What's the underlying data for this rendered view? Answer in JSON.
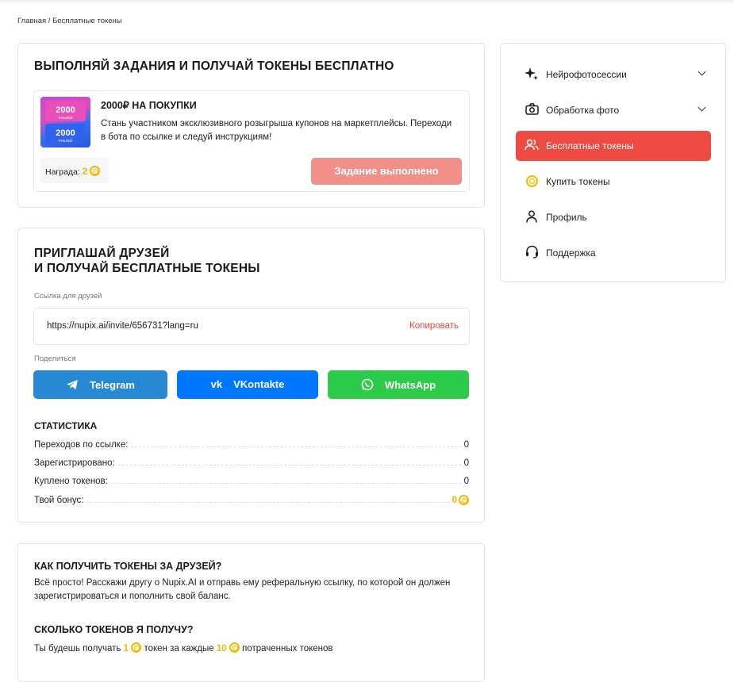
{
  "breadcrumb": "Главная / Бесплатные токены",
  "tasks_card": {
    "title": "ВЫПОЛНЯЙ ЗАДАНИЯ И ПОЛУЧАЙ ТОКЕНЫ БЕСПЛАТНО",
    "task": {
      "thumb_top_amount": "2000",
      "thumb_top_caption": "РУБЛЕЙ",
      "thumb_bottom_amount": "2000",
      "thumb_bottom_caption": "РУБЛЕЙ",
      "title": "2000₽ НА ПОКУПКИ",
      "description": "Стань участником эксклюзивного розыгрыша купонов на маркетплейсы. Переходи в бота по ссылке и следуй инструкциям!",
      "reward_label": "Награда:",
      "reward_value": "2",
      "button_label": "Задание выполнено"
    }
  },
  "invite_card": {
    "title_line1": "ПРИГЛАШАЙ ДРУЗЕЙ",
    "title_line2": "И ПОЛУЧАЙ БЕСПЛАТНЫЕ ТОКЕНЫ",
    "link_label": "Ссылка для друзей",
    "link_url": "https://nupix.ai/invite/656731?lang=ru",
    "copy_label": "Копировать",
    "share_label": "Поделиться",
    "share": {
      "telegram": "Telegram",
      "vk": "VKontakte",
      "whatsapp": "WhatsApp"
    },
    "colors": {
      "telegram": "#2789d3",
      "vk": "#0077ff",
      "whatsapp": "#2ccb49"
    },
    "stats_title": "СТАТИСТИКА",
    "stats": [
      {
        "label": "Переходов по ссылке:",
        "value": "0"
      },
      {
        "label": "Зарегистрировано:",
        "value": "0"
      },
      {
        "label": "Куплено токенов:",
        "value": "0"
      },
      {
        "label": "Твой бонус:",
        "value": "0"
      }
    ]
  },
  "faq_card": {
    "q1": "КАК ПОЛУЧИТЬ ТОКЕНЫ ЗА ДРУЗЕЙ?",
    "a1": "Всё просто! Расскажи другу о Nupix.AI и отправь ему реферальную ссылку, по которой он должен зарегистрироваться и пополнить свой баланс.",
    "q2": "СКОЛЬКО ТОКЕНОВ Я ПОЛУЧУ?",
    "a2_part1": "Ты будешь получать",
    "a2_num1": "1",
    "a2_part2": "токен за каждые",
    "a2_num2": "10",
    "a2_part3": "потраченных токенов"
  },
  "sidebar": {
    "items": [
      {
        "label": "Нейрофотосессии",
        "icon": "sparkle-icon"
      },
      {
        "label": "Обработка фото",
        "icon": "camera-icon"
      },
      {
        "label": "Бесплатные токены",
        "icon": "users-icon"
      },
      {
        "label": "Купить токены",
        "icon": "coins-icon"
      },
      {
        "label": "Профиль",
        "icon": "user-icon"
      },
      {
        "label": "Поддержка",
        "icon": "headset-icon"
      }
    ],
    "active_color": "#ed4a42"
  },
  "accent_color": "#f2b705"
}
